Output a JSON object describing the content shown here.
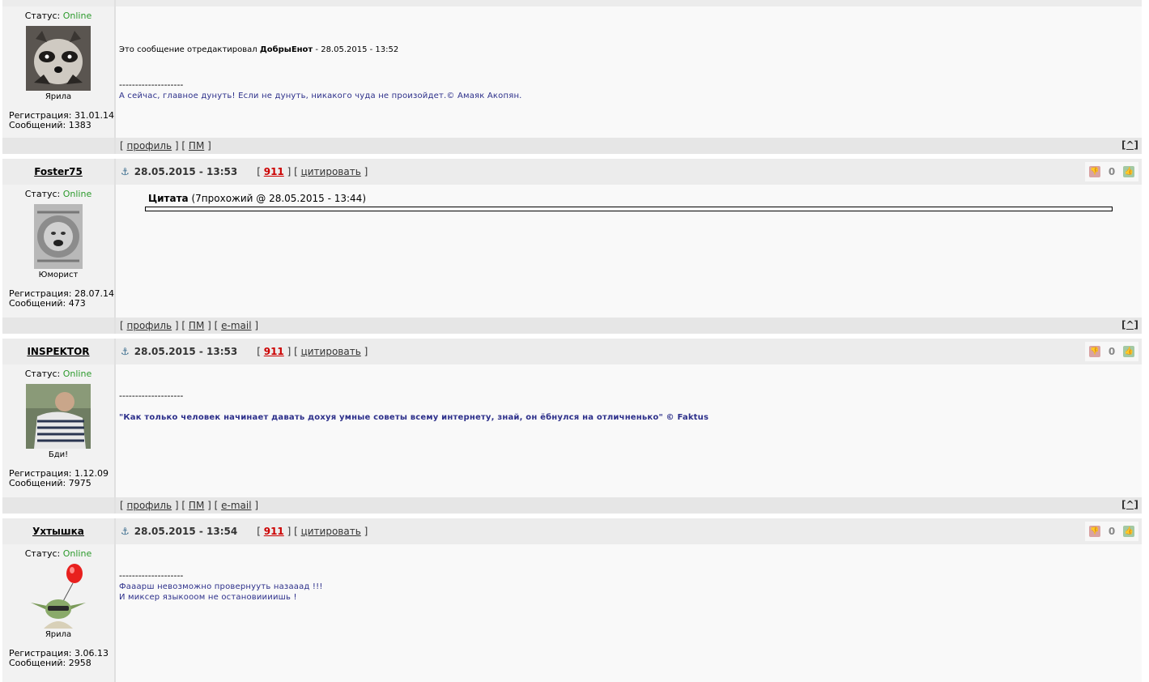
{
  "labels": {
    "status_prefix": "Статус: ",
    "profile": "профиль",
    "pm": "ПМ",
    "email": "e-mail",
    "cite": "цитировать",
    "up": "[^]",
    "anchor": "⚓",
    "dislike": "👎",
    "like": "👍"
  },
  "posts": [
    {
      "status": "Online",
      "rank": "Ярила",
      "reg": "Регистрация: 31.01.14",
      "msgs": "Сообщений: 1383",
      "edit_prefix": "Это сообщение отредактировал ",
      "edit_user": "ДобрыЕнот",
      "edit_suffix": " - 28.05.2015 - 13:52",
      "dashes": "--------------------",
      "sig": "А сейчас, главное дунуть! Если не дунуть, никакого чуда не произойдет.© Амаяк Акопян."
    },
    {
      "username": "Foster75",
      "date": "28.05.2015 - 13:53",
      "num": "911",
      "rating": "0",
      "status": "Online",
      "rank": "Юморист",
      "reg": "Регистрация: 28.07.14",
      "msgs": "Сообщений: 473",
      "quote_label": "Цитата",
      "quote_meta": " (7прохожий @ 28.05.2015 - 13:44)"
    },
    {
      "username": "INSPEKTOR",
      "date": "28.05.2015 - 13:53",
      "num": "911",
      "rating": "0",
      "status": "Online",
      "rank": "Бди!",
      "reg": "Регистрация: 1.12.09",
      "msgs": "Сообщений: 7975",
      "dashes": "--------------------",
      "sig": "\"Как только человек начинает давать дохуя умные советы всему интернету, знай, он ёбнулся на отличненько\" © Faktus"
    },
    {
      "username": "Ухтышка",
      "date": "28.05.2015 - 13:54",
      "num": "911",
      "rating": "0",
      "status": "Online",
      "rank": "Ярила",
      "reg": "Регистрация: 3.06.13",
      "msgs": "Сообщений: 2958",
      "dashes": "--------------------",
      "sig1": "Фааарш невозможно провернууть назааад !!!",
      "sig2": "И миксер языкооом не остановиииишь !"
    }
  ]
}
